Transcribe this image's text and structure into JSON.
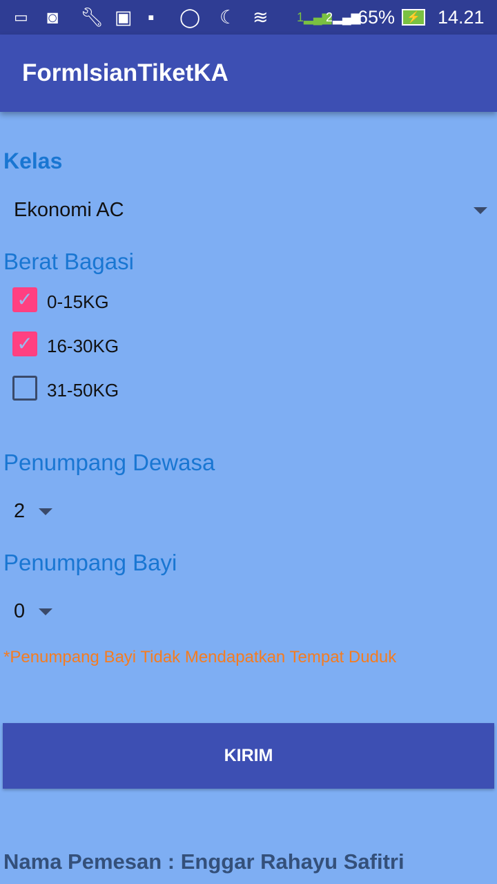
{
  "status_bar": {
    "battery": "65%",
    "time": "14.21",
    "sim1": "1",
    "sim2": "2"
  },
  "app_bar": {
    "title": "FormIsianTiketKA"
  },
  "form": {
    "kelas_label": "Kelas",
    "kelas_value": "Ekonomi AC",
    "bagasi_label": "Berat Bagasi",
    "bagasi_options": [
      {
        "label": "0-15KG",
        "checked": true
      },
      {
        "label": "16-30KG",
        "checked": true
      },
      {
        "label": "31-50KG",
        "checked": false
      }
    ],
    "dewasa_label": "Penumpang Dewasa",
    "dewasa_value": "2",
    "bayi_label": "Penumpang Bayi",
    "bayi_value": "0",
    "note": "*Penumpang Bayi Tidak Mendapatkan Tempat Duduk",
    "submit_label": "KIRIM",
    "nama_pemesan": "Nama Pemesan : Enggar Rahayu Safitri"
  },
  "colors": {
    "accent": "#ff4081",
    "primary": "#3d4fb3",
    "label": "#1976d2",
    "note": "#f57c20"
  }
}
